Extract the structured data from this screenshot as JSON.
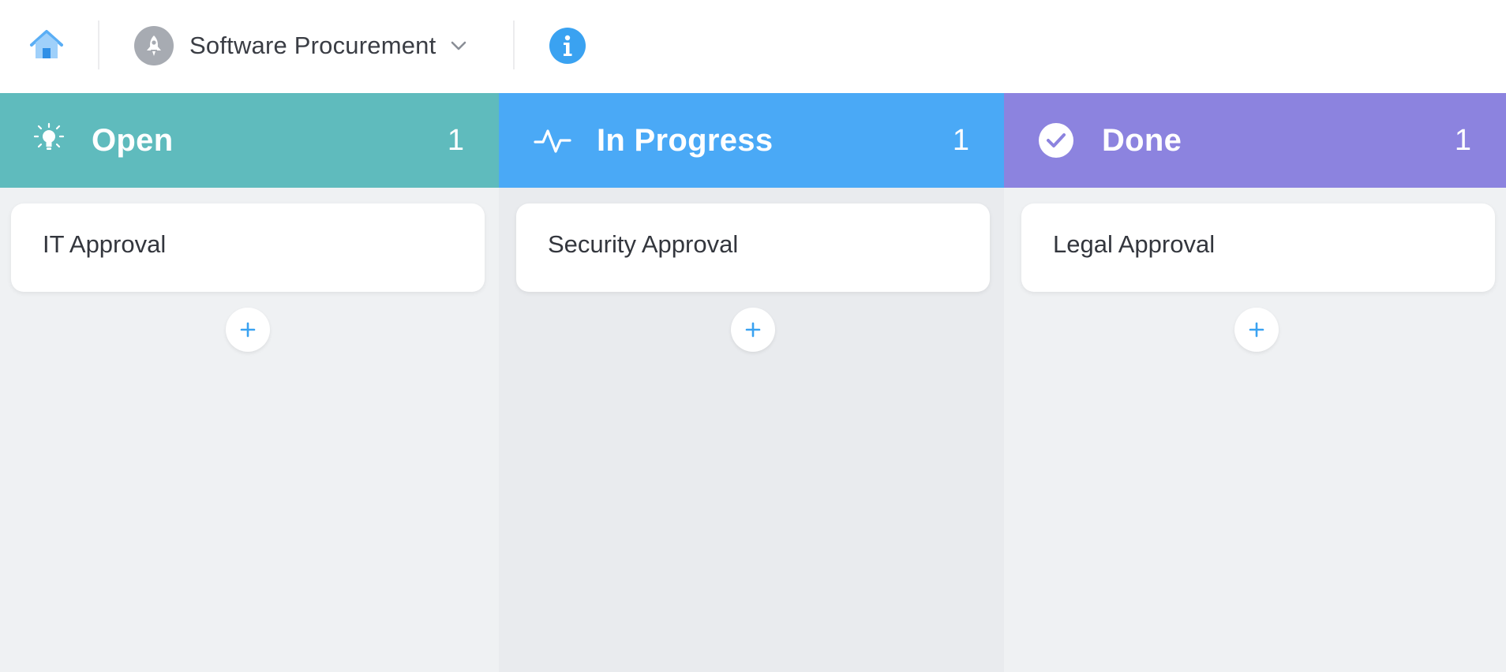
{
  "topbar": {
    "home_icon": "home-icon",
    "board_avatar_icon": "rocket-icon",
    "board_title": "Software Procurement",
    "dropdown_icon": "chevron-down-icon",
    "info_icon": "info-icon"
  },
  "columns": [
    {
      "title": "Open",
      "count": "1",
      "icon": "lightbulb-icon",
      "color": "#5fbbbd",
      "cards": [
        {
          "title": "IT Approval"
        }
      ],
      "add_icon": "plus-icon"
    },
    {
      "title": "In Progress",
      "count": "1",
      "icon": "activity-pulse-icon",
      "color": "#4aa9f6",
      "cards": [
        {
          "title": "Security Approval"
        }
      ],
      "add_icon": "plus-icon"
    },
    {
      "title": "Done",
      "count": "1",
      "icon": "check-circle-icon",
      "color": "#8c83df",
      "cards": [
        {
          "title": "Legal Approval"
        }
      ],
      "add_icon": "plus-icon"
    }
  ],
  "colors": {
    "accent": "#3aa2f1",
    "open": "#5fbbbd",
    "in_progress": "#4aa9f6",
    "done": "#8c83df"
  }
}
